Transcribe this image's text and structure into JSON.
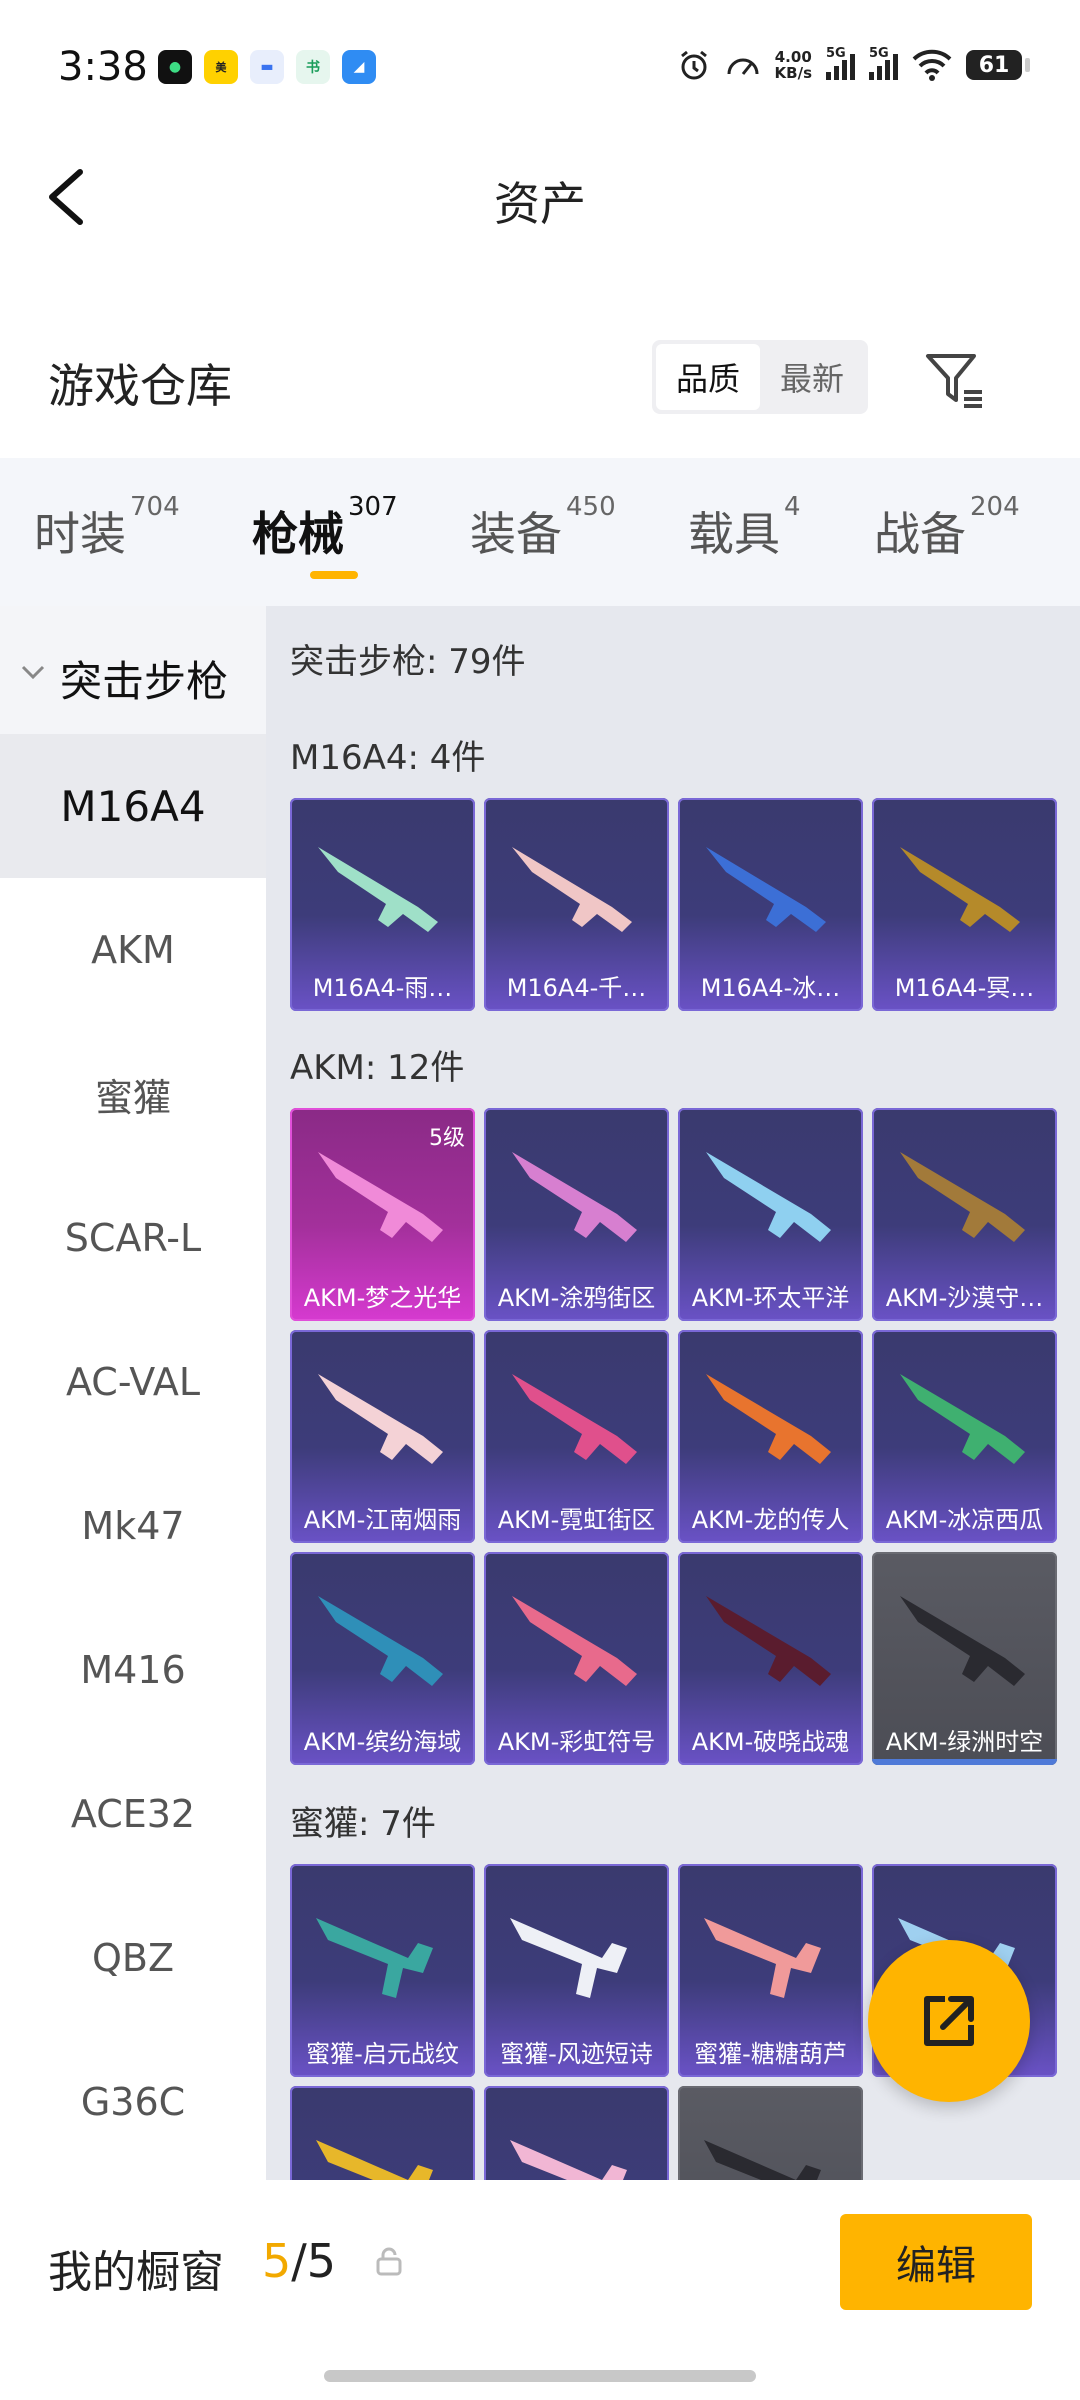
{
  "status": {
    "time": "3:38",
    "speed_value": "4.00",
    "speed_unit": "KB/s",
    "sim1": "5G",
    "sim2": "5G",
    "battery": "61"
  },
  "header": {
    "title": "资产"
  },
  "store": {
    "title": "游戏仓库",
    "sort_quality": "品质",
    "sort_latest": "最新"
  },
  "tabs": [
    {
      "label": "时装",
      "count": "704"
    },
    {
      "label": "枪械",
      "count": "307"
    },
    {
      "label": "装备",
      "count": "450"
    },
    {
      "label": "载具",
      "count": "4"
    },
    {
      "label": "战备",
      "count": "204"
    }
  ],
  "sidebar": {
    "category": "突击步枪",
    "items": [
      "M16A4",
      "AKM",
      "蜜獾",
      "SCAR-L",
      "AC-VAL",
      "Mk47",
      "M416",
      "ACE32",
      "QBZ",
      "G36C"
    ]
  },
  "content": {
    "category_count": "突击步枪: 79件",
    "sections": [
      {
        "title": "M16A4: 4件",
        "items": [
          "M16A4-雨…",
          "M16A4-千…",
          "M16A4-冰…",
          "M16A4-冥…"
        ]
      },
      {
        "title": "AKM: 12件",
        "items": [
          "AKM-梦之光华",
          "AKM-涂鸦街区",
          "AKM-环太平洋",
          "AKM-沙漠守…",
          "AKM-江南烟雨",
          "AKM-霓虹街区",
          "AKM-龙的传人",
          "AKM-冰凉西瓜",
          "AKM-缤纷海域",
          "AKM-彩虹符号",
          "AKM-破晓战魂",
          "AKM-绿洲时空"
        ],
        "first_level": "5级"
      },
      {
        "title": "蜜獾: 7件",
        "items": [
          "蜜獾-启元战纹",
          "蜜獾-风迹短诗",
          "蜜獾-糖糖葫芦",
          "…"
        ]
      }
    ]
  },
  "bottom": {
    "label": "我的橱窗",
    "count_current": "5",
    "count_total": "/5",
    "edit": "编辑"
  },
  "colors": {
    "accent": "#ffb400",
    "card_purple": "#3d3c7a",
    "card_pink": "#a3309b"
  }
}
